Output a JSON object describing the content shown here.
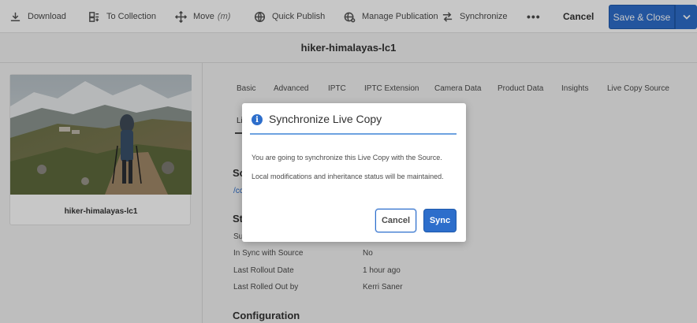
{
  "toolbar": {
    "download": "Download",
    "to_collection": "To Collection",
    "move": "Move",
    "move_shortcut": "(m)",
    "quick_publish": "Quick Publish",
    "manage_publication": "Manage Publication",
    "synchronize": "Synchronize",
    "more": "•••",
    "cancel": "Cancel",
    "save_close": "Save & Close"
  },
  "title": "hiker-himalayas-lc1",
  "asset": {
    "name": "hiker-himalayas-lc1"
  },
  "tabs": [
    "Basic",
    "Advanced",
    "IPTC",
    "IPTC Extension",
    "Camera Data",
    "Product Data",
    "Insights",
    "Live Copy Source"
  ],
  "tab_row2": "Li",
  "sections": {
    "source_title": "So",
    "source_link": "/cc",
    "status_title": "St",
    "status_first_label": "Su",
    "in_sync_label": "In Sync with Source",
    "in_sync_value": "No",
    "last_rollout_label": "Last Rollout Date",
    "last_rollout_value": "1 hour ago",
    "rolled_out_by_label": "Last Rolled Out by",
    "rolled_out_by_value": "Kerri Saner",
    "configuration_title": "Configuration"
  },
  "dialog": {
    "title": "Synchronize Live Copy",
    "line1": "You are going to synchronize this Live Copy with the Source.",
    "line2": "Local modifications and inheritance status will be maintained.",
    "cancel": "Cancel",
    "sync": "Sync"
  },
  "colors": {
    "accent": "#2d6ecb",
    "dialog_rule": "#6ea2e0"
  }
}
